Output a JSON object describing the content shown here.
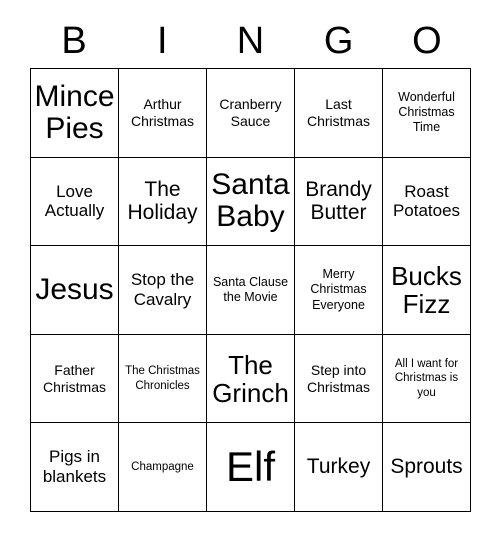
{
  "card": {
    "header_letters": [
      "B",
      "I",
      "N",
      "G",
      "O"
    ],
    "grid": {
      "columns": 5,
      "rows": 5,
      "cells": [
        {
          "text": "Mince Pies",
          "size": "xl"
        },
        {
          "text": "Arthur Christmas",
          "size": "xs"
        },
        {
          "text": "Cranberry Sauce",
          "size": "xs"
        },
        {
          "text": "Last Christmas",
          "size": "xs"
        },
        {
          "text": "Wonderful Christmas Time",
          "size": "xxs"
        },
        {
          "text": "Love Actually",
          "size": "sm"
        },
        {
          "text": "The Holiday",
          "size": "md"
        },
        {
          "text": "Santa Baby",
          "size": "xl"
        },
        {
          "text": "Brandy Butter",
          "size": "md"
        },
        {
          "text": "Roast Potatoes",
          "size": "sm"
        },
        {
          "text": "Jesus",
          "size": "xl"
        },
        {
          "text": "Stop the Cavalry",
          "size": "sm"
        },
        {
          "text": "Santa Clause the Movie",
          "size": "xxs"
        },
        {
          "text": "Merry Christmas Everyone",
          "size": "xxs"
        },
        {
          "text": "Bucks Fizz",
          "size": "lg"
        },
        {
          "text": "Father Christmas",
          "size": "xs"
        },
        {
          "text": "The Christmas Chronicles",
          "size": "tiny"
        },
        {
          "text": "The Grinch",
          "size": "lg"
        },
        {
          "text": "Step into Christmas",
          "size": "xs"
        },
        {
          "text": "All I want for Christmas is you",
          "size": "tiny"
        },
        {
          "text": "Pigs in blankets",
          "size": "sm"
        },
        {
          "text": "Champagne",
          "size": "tiny"
        },
        {
          "text": "Elf",
          "size": "xxl"
        },
        {
          "text": "Turkey",
          "size": "md"
        },
        {
          "text": "Sprouts",
          "size": "md"
        }
      ]
    }
  },
  "colors": {
    "border": "#000000",
    "text": "#000000",
    "background": "#ffffff"
  }
}
